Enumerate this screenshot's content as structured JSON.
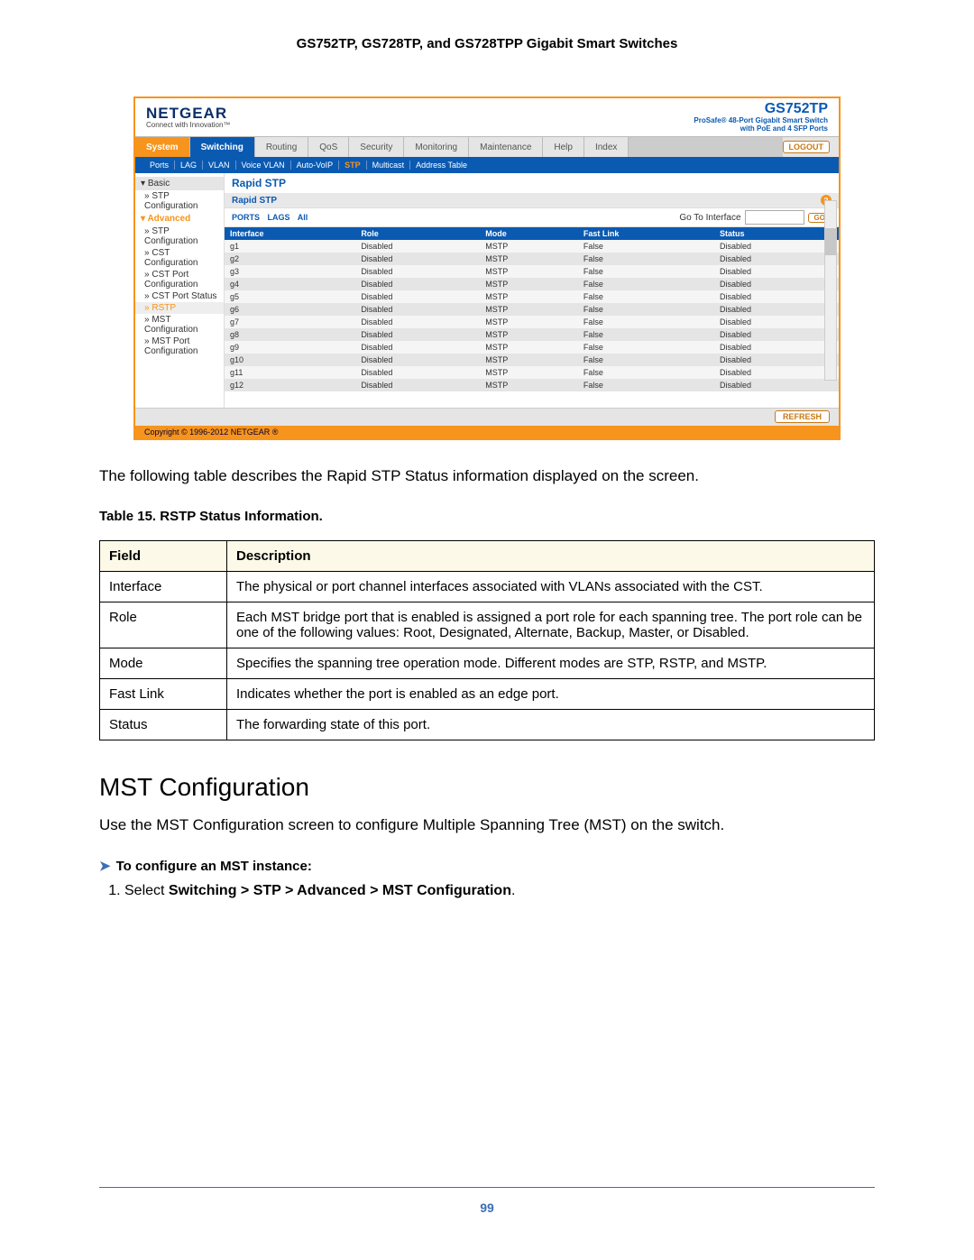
{
  "doc": {
    "title": "GS752TP, GS728TP, and GS728TPP Gigabit Smart Switches",
    "page_number": "99"
  },
  "screenshot": {
    "brand": "NETGEAR",
    "brand_tag": "Connect with Innovation™",
    "model": "GS752TP",
    "model_sub": "ProSafe® 48-Port Gigabit Smart Switch",
    "model_sub2": "with PoE and 4 SFP Ports",
    "logout": "LOGOUT",
    "tabs": [
      "System",
      "Switching",
      "Routing",
      "QoS",
      "Security",
      "Monitoring",
      "Maintenance",
      "Help",
      "Index"
    ],
    "subtabs": [
      "Ports",
      "LAG",
      "VLAN",
      "Voice VLAN",
      "Auto-VoIP",
      "STP",
      "Multicast",
      "Address Table"
    ],
    "active_subtab": "STP",
    "sidebar": {
      "basic_header": "Basic",
      "basic_items": [
        "STP Configuration"
      ],
      "adv_header": "Advanced",
      "adv_items": [
        "STP Configuration",
        "CST Configuration",
        "CST Port Configuration",
        "CST Port Status",
        "RSTP",
        "MST Configuration",
        "MST Port Configuration"
      ],
      "selected": "RSTP"
    },
    "panel": {
      "title": "Rapid STP",
      "sub": "Rapid STP",
      "ports_label1": "PORTS",
      "ports_label2": "LAGS",
      "ports_label3": "All",
      "goto_label": "Go To Interface",
      "go": "GO",
      "cols": [
        "Interface",
        "Role",
        "Mode",
        "Fast Link",
        "Status"
      ],
      "rows": [
        {
          "i": "g1",
          "r": "Disabled",
          "m": "MSTP",
          "f": "False",
          "s": "Disabled"
        },
        {
          "i": "g2",
          "r": "Disabled",
          "m": "MSTP",
          "f": "False",
          "s": "Disabled"
        },
        {
          "i": "g3",
          "r": "Disabled",
          "m": "MSTP",
          "f": "False",
          "s": "Disabled"
        },
        {
          "i": "g4",
          "r": "Disabled",
          "m": "MSTP",
          "f": "False",
          "s": "Disabled"
        },
        {
          "i": "g5",
          "r": "Disabled",
          "m": "MSTP",
          "f": "False",
          "s": "Disabled"
        },
        {
          "i": "g6",
          "r": "Disabled",
          "m": "MSTP",
          "f": "False",
          "s": "Disabled"
        },
        {
          "i": "g7",
          "r": "Disabled",
          "m": "MSTP",
          "f": "False",
          "s": "Disabled"
        },
        {
          "i": "g8",
          "r": "Disabled",
          "m": "MSTP",
          "f": "False",
          "s": "Disabled"
        },
        {
          "i": "g9",
          "r": "Disabled",
          "m": "MSTP",
          "f": "False",
          "s": "Disabled"
        },
        {
          "i": "g10",
          "r": "Disabled",
          "m": "MSTP",
          "f": "False",
          "s": "Disabled"
        },
        {
          "i": "g11",
          "r": "Disabled",
          "m": "MSTP",
          "f": "False",
          "s": "Disabled"
        },
        {
          "i": "g12",
          "r": "Disabled",
          "m": "MSTP",
          "f": "False",
          "s": "Disabled"
        }
      ],
      "refresh": "REFRESH"
    },
    "copyright": "Copyright © 1996-2012 NETGEAR ®"
  },
  "intro_text": "The following table describes the Rapid STP Status information displayed on the screen.",
  "table_caption": "Table 15.  RSTP Status Information.",
  "info_table": {
    "headers": [
      "Field",
      "Description"
    ],
    "rows": [
      {
        "f": "Interface",
        "d": "The physical or port channel interfaces associated with VLANs associated with the CST."
      },
      {
        "f": "Role",
        "d": "Each MST bridge port that is enabled is assigned a port role for each spanning tree. The port role can be one of the following values: Root, Designated, Alternate, Backup, Master, or Disabled."
      },
      {
        "f": "Mode",
        "d": "Specifies the spanning tree operation mode. Different modes are STP, RSTP, and MSTP."
      },
      {
        "f": "Fast Link",
        "d": "Indicates whether the port is enabled as an edge port."
      },
      {
        "f": "Status",
        "d": "The forwarding state of this port."
      }
    ]
  },
  "section": {
    "heading": "MST Configuration",
    "body": "Use the MST Configuration screen to configure Multiple Spanning Tree (MST) on the switch.",
    "proc_lead": "To configure an MST instance:",
    "step1_prefix": "Select ",
    "step1_bold": "Switching > STP > Advanced > MST Configuration",
    "step1_suffix": "."
  }
}
